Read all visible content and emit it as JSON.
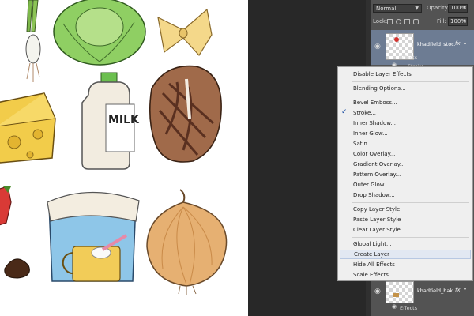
{
  "panel": {
    "blend_mode": "Normal",
    "opacity_label": "Opacity:",
    "opacity_value": "100%",
    "lock_label": "Lock:",
    "fill_label": "Fill:",
    "fill_value": "100%"
  },
  "layers": [
    {
      "name": "khadfield_stoc...",
      "fx": "fx",
      "effects_label": "Effects",
      "stroke_label": "Stroke"
    },
    {
      "name": "khadfield_bak...",
      "fx": "fx",
      "effects_label": "Effects"
    }
  ],
  "menu": {
    "items": [
      {
        "label": "Disable Layer Effects"
      },
      {
        "label": "Blending Options..."
      },
      {
        "label": "Bevel  Emboss..."
      },
      {
        "label": "Stroke...",
        "checked": true
      },
      {
        "label": "Inner Shadow..."
      },
      {
        "label": "Inner Glow..."
      },
      {
        "label": "Satin..."
      },
      {
        "label": "Color Overlay..."
      },
      {
        "label": "Gradient Overlay..."
      },
      {
        "label": "Pattern Overlay..."
      },
      {
        "label": "Outer Glow..."
      },
      {
        "label": "Drop Shadow..."
      },
      {
        "label": "Copy Layer Style"
      },
      {
        "label": "Paste Layer Style"
      },
      {
        "label": "Clear Layer Style"
      },
      {
        "label": "Global Light..."
      },
      {
        "label": "Create Layer",
        "highlighted": true
      },
      {
        "label": "Hide All Effects"
      },
      {
        "label": "Scale Effects..."
      }
    ],
    "check_glyph": "✓"
  },
  "canvas": {
    "milk_label": "MILK"
  },
  "colors": {
    "accent_highlight": "#e2e8f2",
    "layer_selected": "#6d7c93",
    "panel_bg": "#535353"
  },
  "icons": [
    "eye-icon",
    "checkmark-icon",
    "chevron-down-icon",
    "lock-icon",
    "fx-icon"
  ]
}
